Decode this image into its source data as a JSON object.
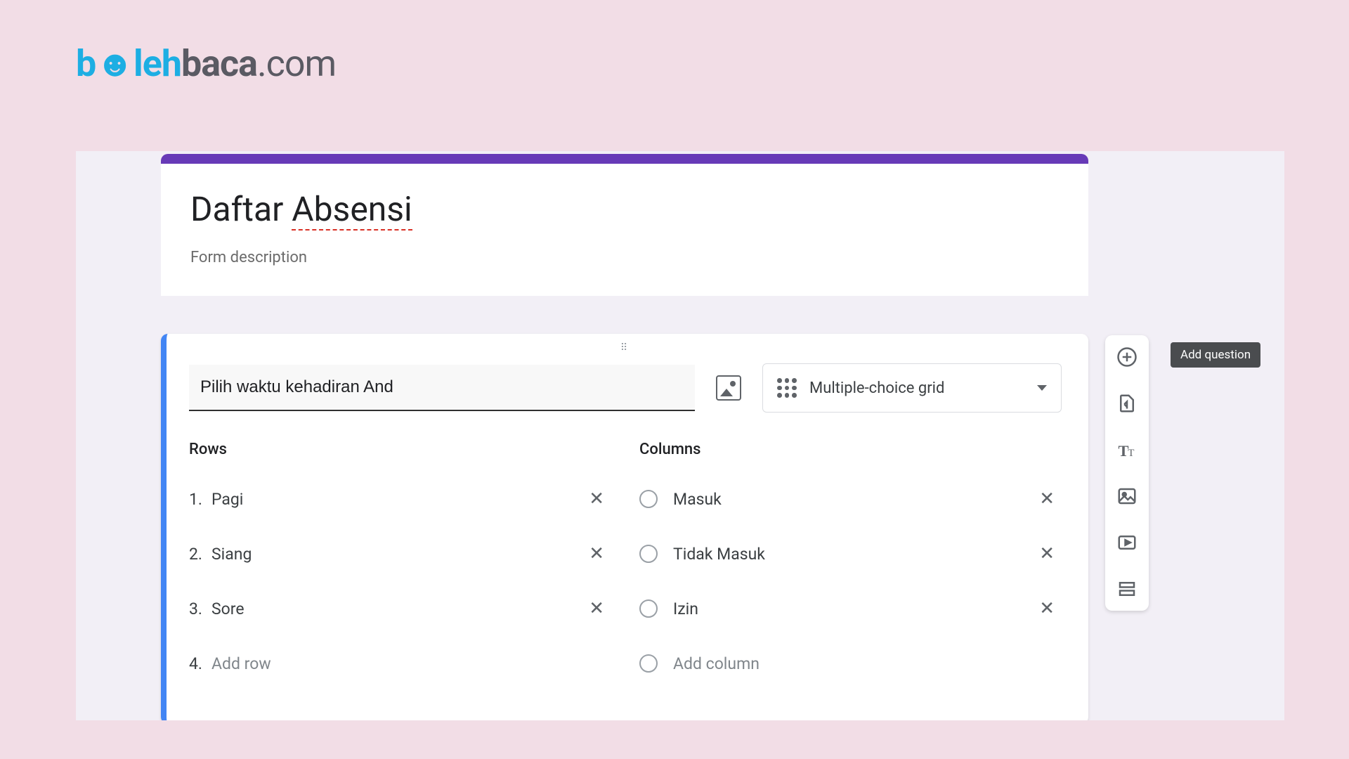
{
  "logo": {
    "part1": "b",
    "part2": "leh",
    "part3": "baca",
    "part4": ".com"
  },
  "form": {
    "title_plain": "Daftar ",
    "title_underlined": "Absensi",
    "description_placeholder": "Form description"
  },
  "question": {
    "text": "Pilih waktu kehadiran And",
    "type_label": "Multiple-choice grid",
    "rows_header": "Rows",
    "columns_header": "Columns",
    "rows": [
      {
        "n": "1.",
        "label": "Pagi"
      },
      {
        "n": "2.",
        "label": "Siang"
      },
      {
        "n": "3.",
        "label": "Sore"
      }
    ],
    "add_row": {
      "n": "4.",
      "label": "Add row"
    },
    "columns": [
      {
        "label": "Masuk"
      },
      {
        "label": "Tidak Masuk"
      },
      {
        "label": "Izin"
      }
    ],
    "add_column": {
      "label": "Add column"
    }
  },
  "toolbar": {
    "tooltip": "Add question"
  },
  "glyph": {
    "x": "✕"
  }
}
